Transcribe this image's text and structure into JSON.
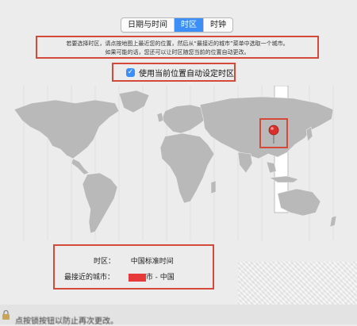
{
  "tabs": [
    {
      "label": "日期与时间"
    },
    {
      "label": "时区"
    },
    {
      "label": "时钟"
    }
  ],
  "hint": {
    "line1": "若要选择时区，请点按地图上最近您的位置，然后从“最接近的城市”菜单中选取一个城市。",
    "line2": "如果可能的话，您还可以让时区随您当前的位置自动更改。"
  },
  "auto_timezone": {
    "label": "使用当前位置自动设定时区",
    "checked": true
  },
  "timezone": {
    "label": "时区：",
    "value": "中国标准时间"
  },
  "closest_city": {
    "label": "最接近的城市：",
    "suffix": "市 - 中国"
  },
  "footer": {
    "text": "点按锁按钮以防止再次更改。"
  },
  "colors": {
    "accent": "#3b8ff6",
    "highlight_box": "#d34a3a",
    "redaction": "#e63a3a",
    "land": "#b9b9b9",
    "ocean": "#ececec"
  }
}
